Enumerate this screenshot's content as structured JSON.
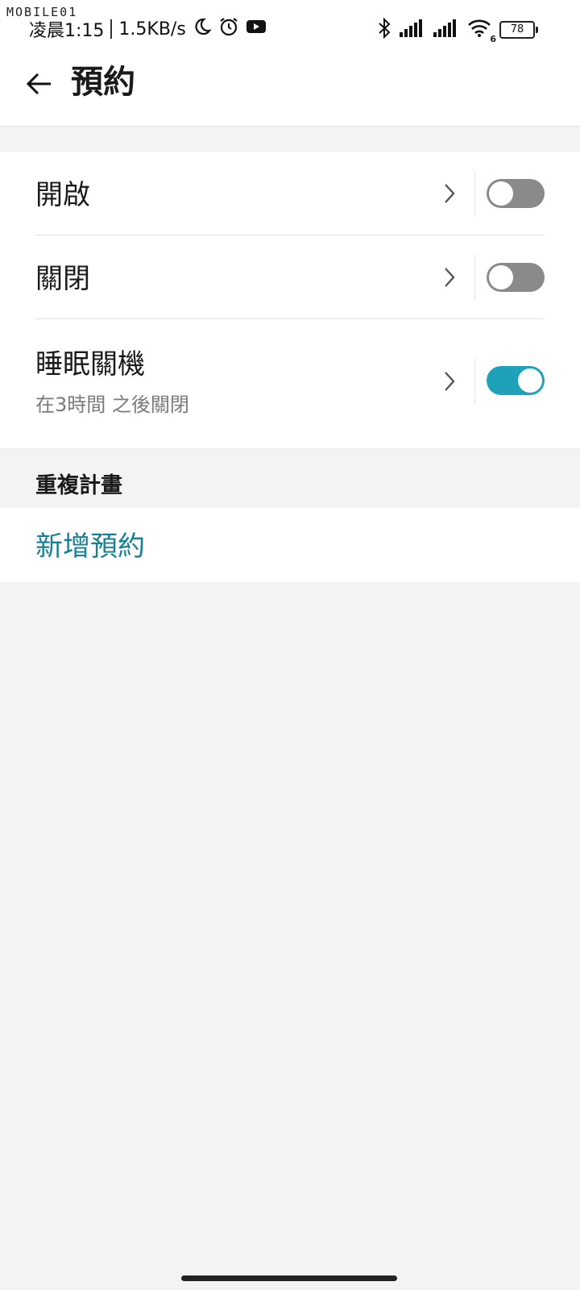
{
  "status_bar": {
    "watermark": "MOBILE01",
    "time": "凌晨1:15",
    "speed": "1.5KB/s",
    "icons_left": [
      "moon-icon",
      "alarm-icon",
      "youtube-icon"
    ],
    "icons_right": [
      "bluetooth-icon",
      "signal-icon",
      "signal-icon",
      "wifi-icon"
    ],
    "wifi_badge": "6",
    "battery": "78"
  },
  "header": {
    "back_icon": "arrow-left-icon",
    "title": "預約"
  },
  "rows": [
    {
      "label": "開啟",
      "subtitle": "",
      "toggle_on": false
    },
    {
      "label": "關閉",
      "subtitle": "",
      "toggle_on": false
    },
    {
      "label": "睡眠關機",
      "subtitle": "在3時間 之後關閉",
      "toggle_on": true
    }
  ],
  "section": {
    "title": "重複計畫",
    "add_label": "新增預約"
  },
  "colors": {
    "accent": "#1fa2b9",
    "link": "#177f93",
    "toggle_off": "#8a8a8a",
    "background": "#f3f3f3"
  }
}
